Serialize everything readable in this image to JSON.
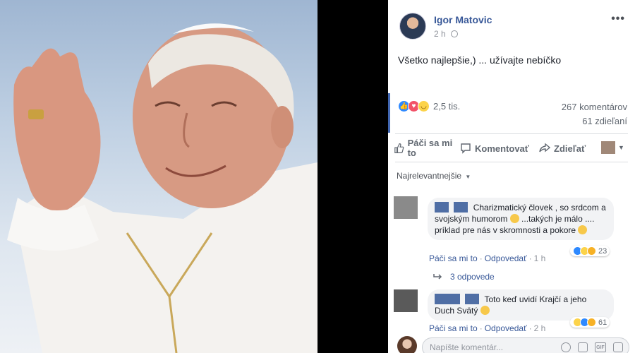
{
  "post": {
    "author": "Igor Matovic",
    "time": "2 h",
    "text": "Všetko najlepšie,) ... užívajte nebíčko",
    "reactions_count": "2,5 tis.",
    "comments_count": "267 komentárov",
    "shares_count": "61 zdieľaní"
  },
  "actions": {
    "like": "Páči sa mi to",
    "comment": "Komentovať",
    "share": "Zdieľať"
  },
  "sort_label": "Najrelevantnejšie",
  "comments": [
    {
      "text_before_emoji": "Charizmatický človek , so srdcom a svojským humorom",
      "text_after_emoji": " ...takých je málo .... príklad pre nás v skromnosti a pokore",
      "like": "Páči sa mi to",
      "reply": "Odpovedať",
      "time": "1 h",
      "reaction_count": "23"
    },
    {
      "text_before_emoji": "Toto keď uvidí Krajčí a jeho Duch Svätý",
      "like": "Páči sa mi to",
      "reply": "Odpovedať",
      "time": "2 h",
      "reaction_count": "61"
    }
  ],
  "replies_label": "3 odpovede",
  "composer": {
    "placeholder": "Napíšte komentár...",
    "gif_label": "GIF"
  },
  "colors": {
    "link_blue": "#385898",
    "fb_blue": "#4267b2",
    "bubble_gray": "#f2f3f5",
    "meta_gray": "#90949c"
  }
}
